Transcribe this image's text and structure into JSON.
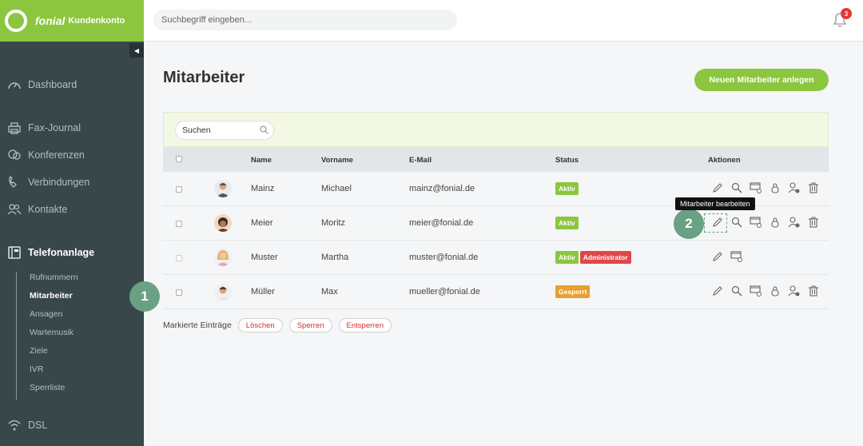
{
  "brand": {
    "name": "fonial",
    "sub": "Kundenkonto"
  },
  "topbar": {
    "search_placeholder": "Suchbegriff eingeben...",
    "notifications": "3"
  },
  "sidebar": {
    "items": [
      {
        "label": "Dashboard"
      },
      {
        "label": "Fax-Journal"
      },
      {
        "label": "Konferenzen"
      },
      {
        "label": "Verbindungen"
      },
      {
        "label": "Kontakte"
      },
      {
        "label": "Telefonanlage"
      },
      {
        "label": "DSL"
      }
    ],
    "subitems": [
      "Rufnummern",
      "Mitarbeiter",
      "Ansagen",
      "Wartemusik",
      "Ziele",
      "IVR",
      "Sperrliste"
    ]
  },
  "main": {
    "title": "Mitarbeiter",
    "new_button": "Neuen Mitarbeiter anlegen",
    "filter_placeholder": "Suchen",
    "columns": [
      "Name",
      "Vorname",
      "E-Mail",
      "Status",
      "Aktionen"
    ],
    "rows": [
      {
        "name": "Mainz",
        "vorname": "Michael",
        "email": "mainz@fonial.de",
        "badges": [
          "Aktiv"
        ]
      },
      {
        "name": "Meier",
        "vorname": "Moritz",
        "email": "meier@fonial.de",
        "badges": [
          "Aktiv"
        ]
      },
      {
        "name": "Muster",
        "vorname": "Martha",
        "email": "muster@fonial.de",
        "badges": [
          "Aktiv",
          "Administrator"
        ]
      },
      {
        "name": "Müller",
        "vorname": "Max",
        "email": "mueller@fonial.de",
        "badges": [
          "Gesperrt"
        ]
      }
    ],
    "bulk": {
      "label": "Markierte Einträge",
      "delete": "Löschen",
      "block": "Sperren",
      "unblock": "Entsperren"
    }
  },
  "tooltip": "Mitarbeiter bearbeiten",
  "steps": [
    "1",
    "2"
  ],
  "colors": {
    "brand": "#8cc63f",
    "sidebar": "#37474a",
    "active": "#8cc63f",
    "admin": "#e04848",
    "blocked": "#e8a030",
    "step": "#6aa084"
  }
}
